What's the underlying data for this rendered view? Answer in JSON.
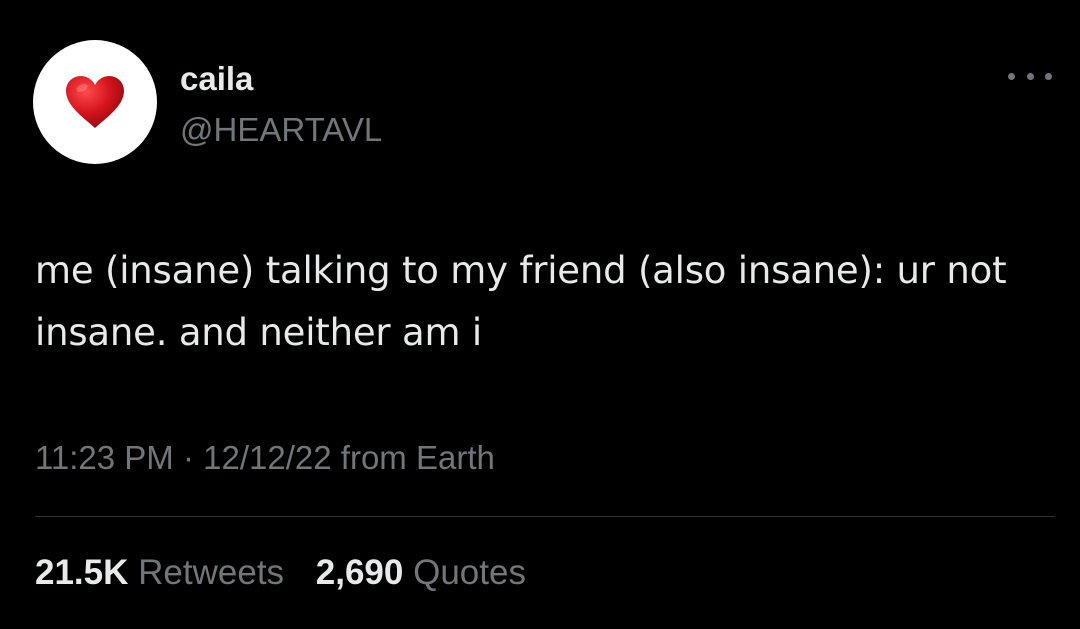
{
  "user": {
    "display_name": "caila",
    "handle": "@HEARTAVL",
    "avatar_icon": "heart-icon"
  },
  "tweet": {
    "text": "me (insane) talking to my friend (also insane): ur not insane. and neither am i",
    "time": "11:23 PM",
    "separator": "·",
    "date": "12/12/22",
    "source": "from Earth"
  },
  "stats": {
    "retweets_count": "21.5K",
    "retweets_label": "Retweets",
    "quotes_count": "2,690",
    "quotes_label": "Quotes"
  },
  "colors": {
    "background": "#000000",
    "primary_text": "#e7e9ea",
    "secondary_text": "#71767b",
    "divider": "#2f3336",
    "heart": "#c8141e"
  }
}
